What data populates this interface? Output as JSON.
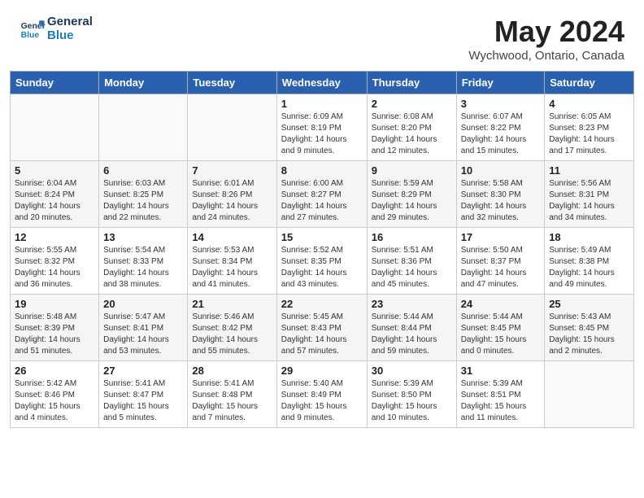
{
  "header": {
    "logo_line1": "General",
    "logo_line2": "Blue",
    "month": "May 2024",
    "location": "Wychwood, Ontario, Canada"
  },
  "days_of_week": [
    "Sunday",
    "Monday",
    "Tuesday",
    "Wednesday",
    "Thursday",
    "Friday",
    "Saturday"
  ],
  "weeks": [
    [
      {
        "day": "",
        "info": ""
      },
      {
        "day": "",
        "info": ""
      },
      {
        "day": "",
        "info": ""
      },
      {
        "day": "1",
        "info": "Sunrise: 6:09 AM\nSunset: 8:19 PM\nDaylight: 14 hours\nand 9 minutes."
      },
      {
        "day": "2",
        "info": "Sunrise: 6:08 AM\nSunset: 8:20 PM\nDaylight: 14 hours\nand 12 minutes."
      },
      {
        "day": "3",
        "info": "Sunrise: 6:07 AM\nSunset: 8:22 PM\nDaylight: 14 hours\nand 15 minutes."
      },
      {
        "day": "4",
        "info": "Sunrise: 6:05 AM\nSunset: 8:23 PM\nDaylight: 14 hours\nand 17 minutes."
      }
    ],
    [
      {
        "day": "5",
        "info": "Sunrise: 6:04 AM\nSunset: 8:24 PM\nDaylight: 14 hours\nand 20 minutes."
      },
      {
        "day": "6",
        "info": "Sunrise: 6:03 AM\nSunset: 8:25 PM\nDaylight: 14 hours\nand 22 minutes."
      },
      {
        "day": "7",
        "info": "Sunrise: 6:01 AM\nSunset: 8:26 PM\nDaylight: 14 hours\nand 24 minutes."
      },
      {
        "day": "8",
        "info": "Sunrise: 6:00 AM\nSunset: 8:27 PM\nDaylight: 14 hours\nand 27 minutes."
      },
      {
        "day": "9",
        "info": "Sunrise: 5:59 AM\nSunset: 8:29 PM\nDaylight: 14 hours\nand 29 minutes."
      },
      {
        "day": "10",
        "info": "Sunrise: 5:58 AM\nSunset: 8:30 PM\nDaylight: 14 hours\nand 32 minutes."
      },
      {
        "day": "11",
        "info": "Sunrise: 5:56 AM\nSunset: 8:31 PM\nDaylight: 14 hours\nand 34 minutes."
      }
    ],
    [
      {
        "day": "12",
        "info": "Sunrise: 5:55 AM\nSunset: 8:32 PM\nDaylight: 14 hours\nand 36 minutes."
      },
      {
        "day": "13",
        "info": "Sunrise: 5:54 AM\nSunset: 8:33 PM\nDaylight: 14 hours\nand 38 minutes."
      },
      {
        "day": "14",
        "info": "Sunrise: 5:53 AM\nSunset: 8:34 PM\nDaylight: 14 hours\nand 41 minutes."
      },
      {
        "day": "15",
        "info": "Sunrise: 5:52 AM\nSunset: 8:35 PM\nDaylight: 14 hours\nand 43 minutes."
      },
      {
        "day": "16",
        "info": "Sunrise: 5:51 AM\nSunset: 8:36 PM\nDaylight: 14 hours\nand 45 minutes."
      },
      {
        "day": "17",
        "info": "Sunrise: 5:50 AM\nSunset: 8:37 PM\nDaylight: 14 hours\nand 47 minutes."
      },
      {
        "day": "18",
        "info": "Sunrise: 5:49 AM\nSunset: 8:38 PM\nDaylight: 14 hours\nand 49 minutes."
      }
    ],
    [
      {
        "day": "19",
        "info": "Sunrise: 5:48 AM\nSunset: 8:39 PM\nDaylight: 14 hours\nand 51 minutes."
      },
      {
        "day": "20",
        "info": "Sunrise: 5:47 AM\nSunset: 8:41 PM\nDaylight: 14 hours\nand 53 minutes."
      },
      {
        "day": "21",
        "info": "Sunrise: 5:46 AM\nSunset: 8:42 PM\nDaylight: 14 hours\nand 55 minutes."
      },
      {
        "day": "22",
        "info": "Sunrise: 5:45 AM\nSunset: 8:43 PM\nDaylight: 14 hours\nand 57 minutes."
      },
      {
        "day": "23",
        "info": "Sunrise: 5:44 AM\nSunset: 8:44 PM\nDaylight: 14 hours\nand 59 minutes."
      },
      {
        "day": "24",
        "info": "Sunrise: 5:44 AM\nSunset: 8:45 PM\nDaylight: 15 hours\nand 0 minutes."
      },
      {
        "day": "25",
        "info": "Sunrise: 5:43 AM\nSunset: 8:45 PM\nDaylight: 15 hours\nand 2 minutes."
      }
    ],
    [
      {
        "day": "26",
        "info": "Sunrise: 5:42 AM\nSunset: 8:46 PM\nDaylight: 15 hours\nand 4 minutes."
      },
      {
        "day": "27",
        "info": "Sunrise: 5:41 AM\nSunset: 8:47 PM\nDaylight: 15 hours\nand 5 minutes."
      },
      {
        "day": "28",
        "info": "Sunrise: 5:41 AM\nSunset: 8:48 PM\nDaylight: 15 hours\nand 7 minutes."
      },
      {
        "day": "29",
        "info": "Sunrise: 5:40 AM\nSunset: 8:49 PM\nDaylight: 15 hours\nand 9 minutes."
      },
      {
        "day": "30",
        "info": "Sunrise: 5:39 AM\nSunset: 8:50 PM\nDaylight: 15 hours\nand 10 minutes."
      },
      {
        "day": "31",
        "info": "Sunrise: 5:39 AM\nSunset: 8:51 PM\nDaylight: 15 hours\nand 11 minutes."
      },
      {
        "day": "",
        "info": ""
      }
    ]
  ]
}
